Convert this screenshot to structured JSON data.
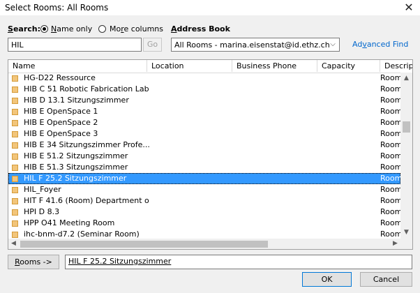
{
  "window": {
    "title": "Select Rooms: All Rooms",
    "close_glyph": "✕"
  },
  "search": {
    "label": "Search:",
    "options": [
      {
        "label": "Name only",
        "selected": true
      },
      {
        "label": "More columns",
        "selected": false
      }
    ],
    "value": "HIL",
    "go_label": "Go"
  },
  "address_book": {
    "label": "Address Book",
    "selected": "All Rooms - marina.eisenstat@id.ethz.ch",
    "chevron": "⌵"
  },
  "advanced_find": "Advanced Find",
  "columns": [
    "Name",
    "Location",
    "Business Phone",
    "Capacity",
    "Descrip"
  ],
  "rows": [
    {
      "name": "HG-D22  Ressource",
      "desc": "Room",
      "selected": false
    },
    {
      "name": "HIB C 51  Robotic Fabrication Lab",
      "desc": "Room",
      "selected": false
    },
    {
      "name": "HIB D 13.1  Sitzungszimmer",
      "desc": "Room",
      "selected": false
    },
    {
      "name": "HIB E  OpenSpace 1",
      "desc": "Room",
      "selected": false
    },
    {
      "name": "HIB E  OpenSpace 2",
      "desc": "Room",
      "selected": false
    },
    {
      "name": "HIB E  OpenSpace 3",
      "desc": "Room",
      "selected": false
    },
    {
      "name": "HIB E 34  Sitzungszimmer Profe...",
      "desc": "Room",
      "selected": false
    },
    {
      "name": "HIB E 51.2  Sitzungszimmer",
      "desc": "Room",
      "selected": false
    },
    {
      "name": "HIB E 51.3  Sitzungszimmer",
      "desc": "Room",
      "selected": false
    },
    {
      "name": "HIL F 25.2 Sitzungszimmer",
      "desc": "Room",
      "selected": true
    },
    {
      "name": "HIL_Foyer",
      "desc": "Room",
      "selected": false
    },
    {
      "name": "HIT F 41.6 (Room) Department o...",
      "desc": "Room",
      "selected": false
    },
    {
      "name": "HPI D 8.3",
      "desc": "Room",
      "selected": false
    },
    {
      "name": "HPP O41 Meeting Room",
      "desc": "Room",
      "selected": false
    },
    {
      "name": "ihc-bnm-d7.2 (Seminar Room)",
      "desc": "Room",
      "selected": false
    }
  ],
  "scroll": {
    "up": "▲",
    "down": "▼",
    "left": "◀",
    "right": "▶"
  },
  "rooms_button": "Rooms ->",
  "rooms_value": "HIL F 25.2 Sitzungszimmer",
  "ok_label": "OK",
  "cancel_label": "Cancel"
}
